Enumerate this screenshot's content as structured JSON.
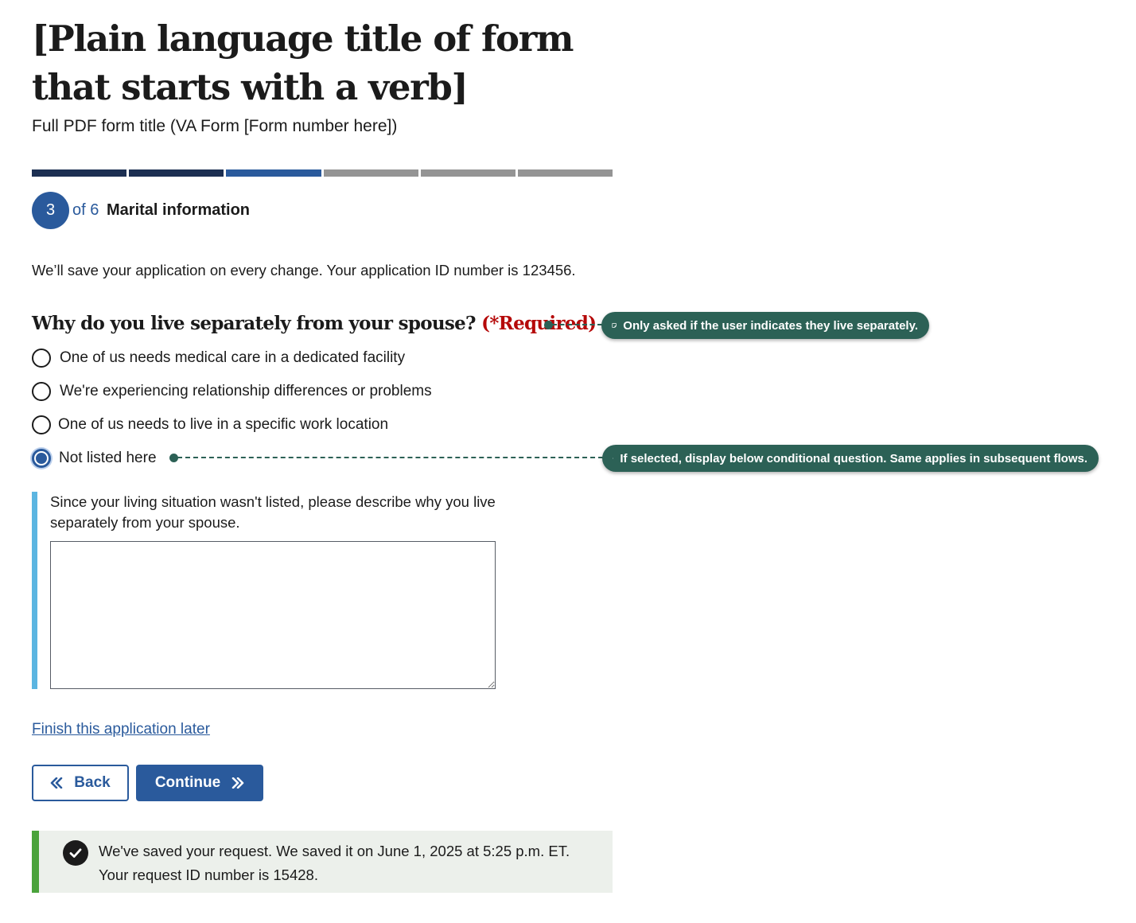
{
  "page": {
    "title": "[Plain language title of form that starts with a verb]",
    "subtitle": "Full PDF form title (VA Form [Form number here])"
  },
  "progress": {
    "total_steps": 6,
    "current_step": 3,
    "segment_colors": [
      "#1c2f52",
      "#1c2f52",
      "#2a5a9c",
      "#949494",
      "#949494",
      "#949494"
    ]
  },
  "step": {
    "number": "3",
    "of_text": "of 6",
    "name": "Marital information"
  },
  "save_note": "We’ll save your application on every change. Your application ID number is 123456.",
  "question": {
    "text": "Why do you live separately from your spouse?",
    "required_text": "(*Required)",
    "options": [
      {
        "label": "One of us needs medical care in a dedicated facility",
        "checked": false
      },
      {
        "label": "We're experiencing relationship differences or problems",
        "checked": false
      },
      {
        "label": "One of us needs to live in a specific work location",
        "checked": false
      },
      {
        "label": "Not listed here",
        "checked": true
      }
    ]
  },
  "conditional": {
    "label": "Since your living situation wasn't listed, please describe why you live separately from your spouse.",
    "value": ""
  },
  "finish_link": "Finish this application later",
  "buttons": {
    "back_label": "Back",
    "continue_label": "Continue"
  },
  "alert": {
    "line1": "We've saved your request. We saved it on June 1, 2025 at 5:25 p.m. ET.",
    "line2": "Your request ID number is 15428."
  },
  "annotations": [
    {
      "text": "Only asked if the user indicates they live separately."
    },
    {
      "text": "If selected, display below conditional question. Same applies in subsequent flows."
    }
  ],
  "colors": {
    "primary": "#2a5a9c",
    "required": "#b50909",
    "conditional_bar": "#5bb5e1",
    "success": "#4aa33b",
    "annotation": "#2c6156"
  }
}
